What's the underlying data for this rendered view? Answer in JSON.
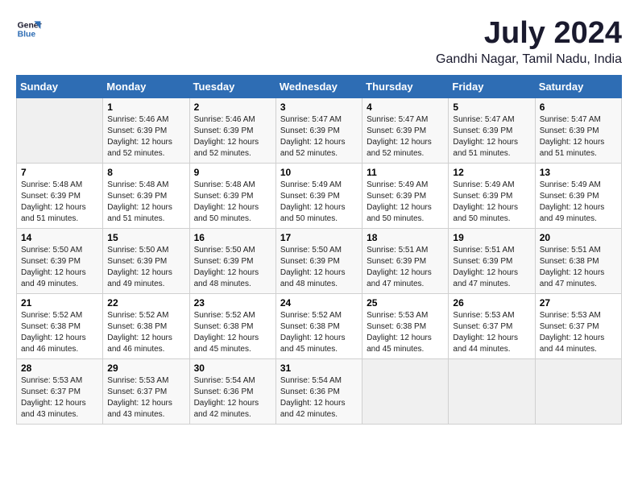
{
  "logo": {
    "line1": "General",
    "line2": "Blue"
  },
  "title": "July 2024",
  "subtitle": "Gandhi Nagar, Tamil Nadu, India",
  "weekdays": [
    "Sunday",
    "Monday",
    "Tuesday",
    "Wednesday",
    "Thursday",
    "Friday",
    "Saturday"
  ],
  "weeks": [
    [
      {
        "day": "",
        "sunrise": "",
        "sunset": "",
        "daylight": ""
      },
      {
        "day": "1",
        "sunrise": "Sunrise: 5:46 AM",
        "sunset": "Sunset: 6:39 PM",
        "daylight": "Daylight: 12 hours and 52 minutes."
      },
      {
        "day": "2",
        "sunrise": "Sunrise: 5:46 AM",
        "sunset": "Sunset: 6:39 PM",
        "daylight": "Daylight: 12 hours and 52 minutes."
      },
      {
        "day": "3",
        "sunrise": "Sunrise: 5:47 AM",
        "sunset": "Sunset: 6:39 PM",
        "daylight": "Daylight: 12 hours and 52 minutes."
      },
      {
        "day": "4",
        "sunrise": "Sunrise: 5:47 AM",
        "sunset": "Sunset: 6:39 PM",
        "daylight": "Daylight: 12 hours and 52 minutes."
      },
      {
        "day": "5",
        "sunrise": "Sunrise: 5:47 AM",
        "sunset": "Sunset: 6:39 PM",
        "daylight": "Daylight: 12 hours and 51 minutes."
      },
      {
        "day": "6",
        "sunrise": "Sunrise: 5:47 AM",
        "sunset": "Sunset: 6:39 PM",
        "daylight": "Daylight: 12 hours and 51 minutes."
      }
    ],
    [
      {
        "day": "7",
        "sunrise": "Sunrise: 5:48 AM",
        "sunset": "Sunset: 6:39 PM",
        "daylight": "Daylight: 12 hours and 51 minutes."
      },
      {
        "day": "8",
        "sunrise": "Sunrise: 5:48 AM",
        "sunset": "Sunset: 6:39 PM",
        "daylight": "Daylight: 12 hours and 51 minutes."
      },
      {
        "day": "9",
        "sunrise": "Sunrise: 5:48 AM",
        "sunset": "Sunset: 6:39 PM",
        "daylight": "Daylight: 12 hours and 50 minutes."
      },
      {
        "day": "10",
        "sunrise": "Sunrise: 5:49 AM",
        "sunset": "Sunset: 6:39 PM",
        "daylight": "Daylight: 12 hours and 50 minutes."
      },
      {
        "day": "11",
        "sunrise": "Sunrise: 5:49 AM",
        "sunset": "Sunset: 6:39 PM",
        "daylight": "Daylight: 12 hours and 50 minutes."
      },
      {
        "day": "12",
        "sunrise": "Sunrise: 5:49 AM",
        "sunset": "Sunset: 6:39 PM",
        "daylight": "Daylight: 12 hours and 50 minutes."
      },
      {
        "day": "13",
        "sunrise": "Sunrise: 5:49 AM",
        "sunset": "Sunset: 6:39 PM",
        "daylight": "Daylight: 12 hours and 49 minutes."
      }
    ],
    [
      {
        "day": "14",
        "sunrise": "Sunrise: 5:50 AM",
        "sunset": "Sunset: 6:39 PM",
        "daylight": "Daylight: 12 hours and 49 minutes."
      },
      {
        "day": "15",
        "sunrise": "Sunrise: 5:50 AM",
        "sunset": "Sunset: 6:39 PM",
        "daylight": "Daylight: 12 hours and 49 minutes."
      },
      {
        "day": "16",
        "sunrise": "Sunrise: 5:50 AM",
        "sunset": "Sunset: 6:39 PM",
        "daylight": "Daylight: 12 hours and 48 minutes."
      },
      {
        "day": "17",
        "sunrise": "Sunrise: 5:50 AM",
        "sunset": "Sunset: 6:39 PM",
        "daylight": "Daylight: 12 hours and 48 minutes."
      },
      {
        "day": "18",
        "sunrise": "Sunrise: 5:51 AM",
        "sunset": "Sunset: 6:39 PM",
        "daylight": "Daylight: 12 hours and 47 minutes."
      },
      {
        "day": "19",
        "sunrise": "Sunrise: 5:51 AM",
        "sunset": "Sunset: 6:39 PM",
        "daylight": "Daylight: 12 hours and 47 minutes."
      },
      {
        "day": "20",
        "sunrise": "Sunrise: 5:51 AM",
        "sunset": "Sunset: 6:38 PM",
        "daylight": "Daylight: 12 hours and 47 minutes."
      }
    ],
    [
      {
        "day": "21",
        "sunrise": "Sunrise: 5:52 AM",
        "sunset": "Sunset: 6:38 PM",
        "daylight": "Daylight: 12 hours and 46 minutes."
      },
      {
        "day": "22",
        "sunrise": "Sunrise: 5:52 AM",
        "sunset": "Sunset: 6:38 PM",
        "daylight": "Daylight: 12 hours and 46 minutes."
      },
      {
        "day": "23",
        "sunrise": "Sunrise: 5:52 AM",
        "sunset": "Sunset: 6:38 PM",
        "daylight": "Daylight: 12 hours and 45 minutes."
      },
      {
        "day": "24",
        "sunrise": "Sunrise: 5:52 AM",
        "sunset": "Sunset: 6:38 PM",
        "daylight": "Daylight: 12 hours and 45 minutes."
      },
      {
        "day": "25",
        "sunrise": "Sunrise: 5:53 AM",
        "sunset": "Sunset: 6:38 PM",
        "daylight": "Daylight: 12 hours and 45 minutes."
      },
      {
        "day": "26",
        "sunrise": "Sunrise: 5:53 AM",
        "sunset": "Sunset: 6:37 PM",
        "daylight": "Daylight: 12 hours and 44 minutes."
      },
      {
        "day": "27",
        "sunrise": "Sunrise: 5:53 AM",
        "sunset": "Sunset: 6:37 PM",
        "daylight": "Daylight: 12 hours and 44 minutes."
      }
    ],
    [
      {
        "day": "28",
        "sunrise": "Sunrise: 5:53 AM",
        "sunset": "Sunset: 6:37 PM",
        "daylight": "Daylight: 12 hours and 43 minutes."
      },
      {
        "day": "29",
        "sunrise": "Sunrise: 5:53 AM",
        "sunset": "Sunset: 6:37 PM",
        "daylight": "Daylight: 12 hours and 43 minutes."
      },
      {
        "day": "30",
        "sunrise": "Sunrise: 5:54 AM",
        "sunset": "Sunset: 6:36 PM",
        "daylight": "Daylight: 12 hours and 42 minutes."
      },
      {
        "day": "31",
        "sunrise": "Sunrise: 5:54 AM",
        "sunset": "Sunset: 6:36 PM",
        "daylight": "Daylight: 12 hours and 42 minutes."
      },
      {
        "day": "",
        "sunrise": "",
        "sunset": "",
        "daylight": ""
      },
      {
        "day": "",
        "sunrise": "",
        "sunset": "",
        "daylight": ""
      },
      {
        "day": "",
        "sunrise": "",
        "sunset": "",
        "daylight": ""
      }
    ]
  ]
}
